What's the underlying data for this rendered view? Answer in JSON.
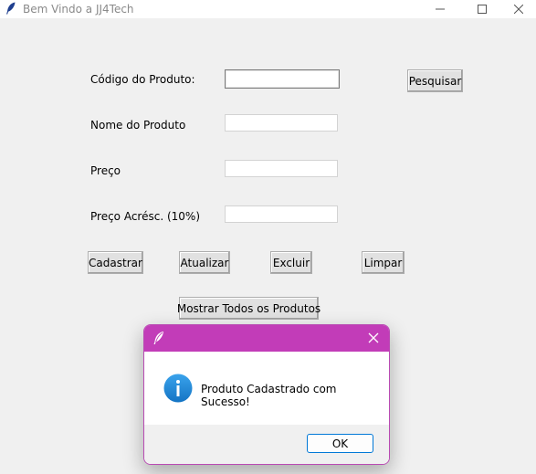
{
  "window": {
    "title": "Bem Vindo a JJ4Tech"
  },
  "form": {
    "codigo_label": "Código do Produto:",
    "codigo_value": "",
    "nome_label": "Nome do Produto",
    "nome_value": "",
    "preco_label": "Preço",
    "preco_value": "",
    "preco_acresc_label": "Preço Acrésc. (10%)",
    "preco_acresc_value": ""
  },
  "buttons": {
    "pesquisar": "Pesquisar",
    "cadastrar": "Cadastrar",
    "atualizar": "Atualizar",
    "excluir": "Excluir",
    "limpar": "Limpar",
    "mostrar_todos": "Mostrar Todos os Produtos"
  },
  "dialog": {
    "message": "Produto Cadastrado com Sucesso!",
    "ok_label": "OK",
    "icon": "info-icon"
  },
  "colors": {
    "dialog_titlebar": "#c23cb8",
    "info_icon": "#1b86d6",
    "ok_border": "#0078d7"
  }
}
